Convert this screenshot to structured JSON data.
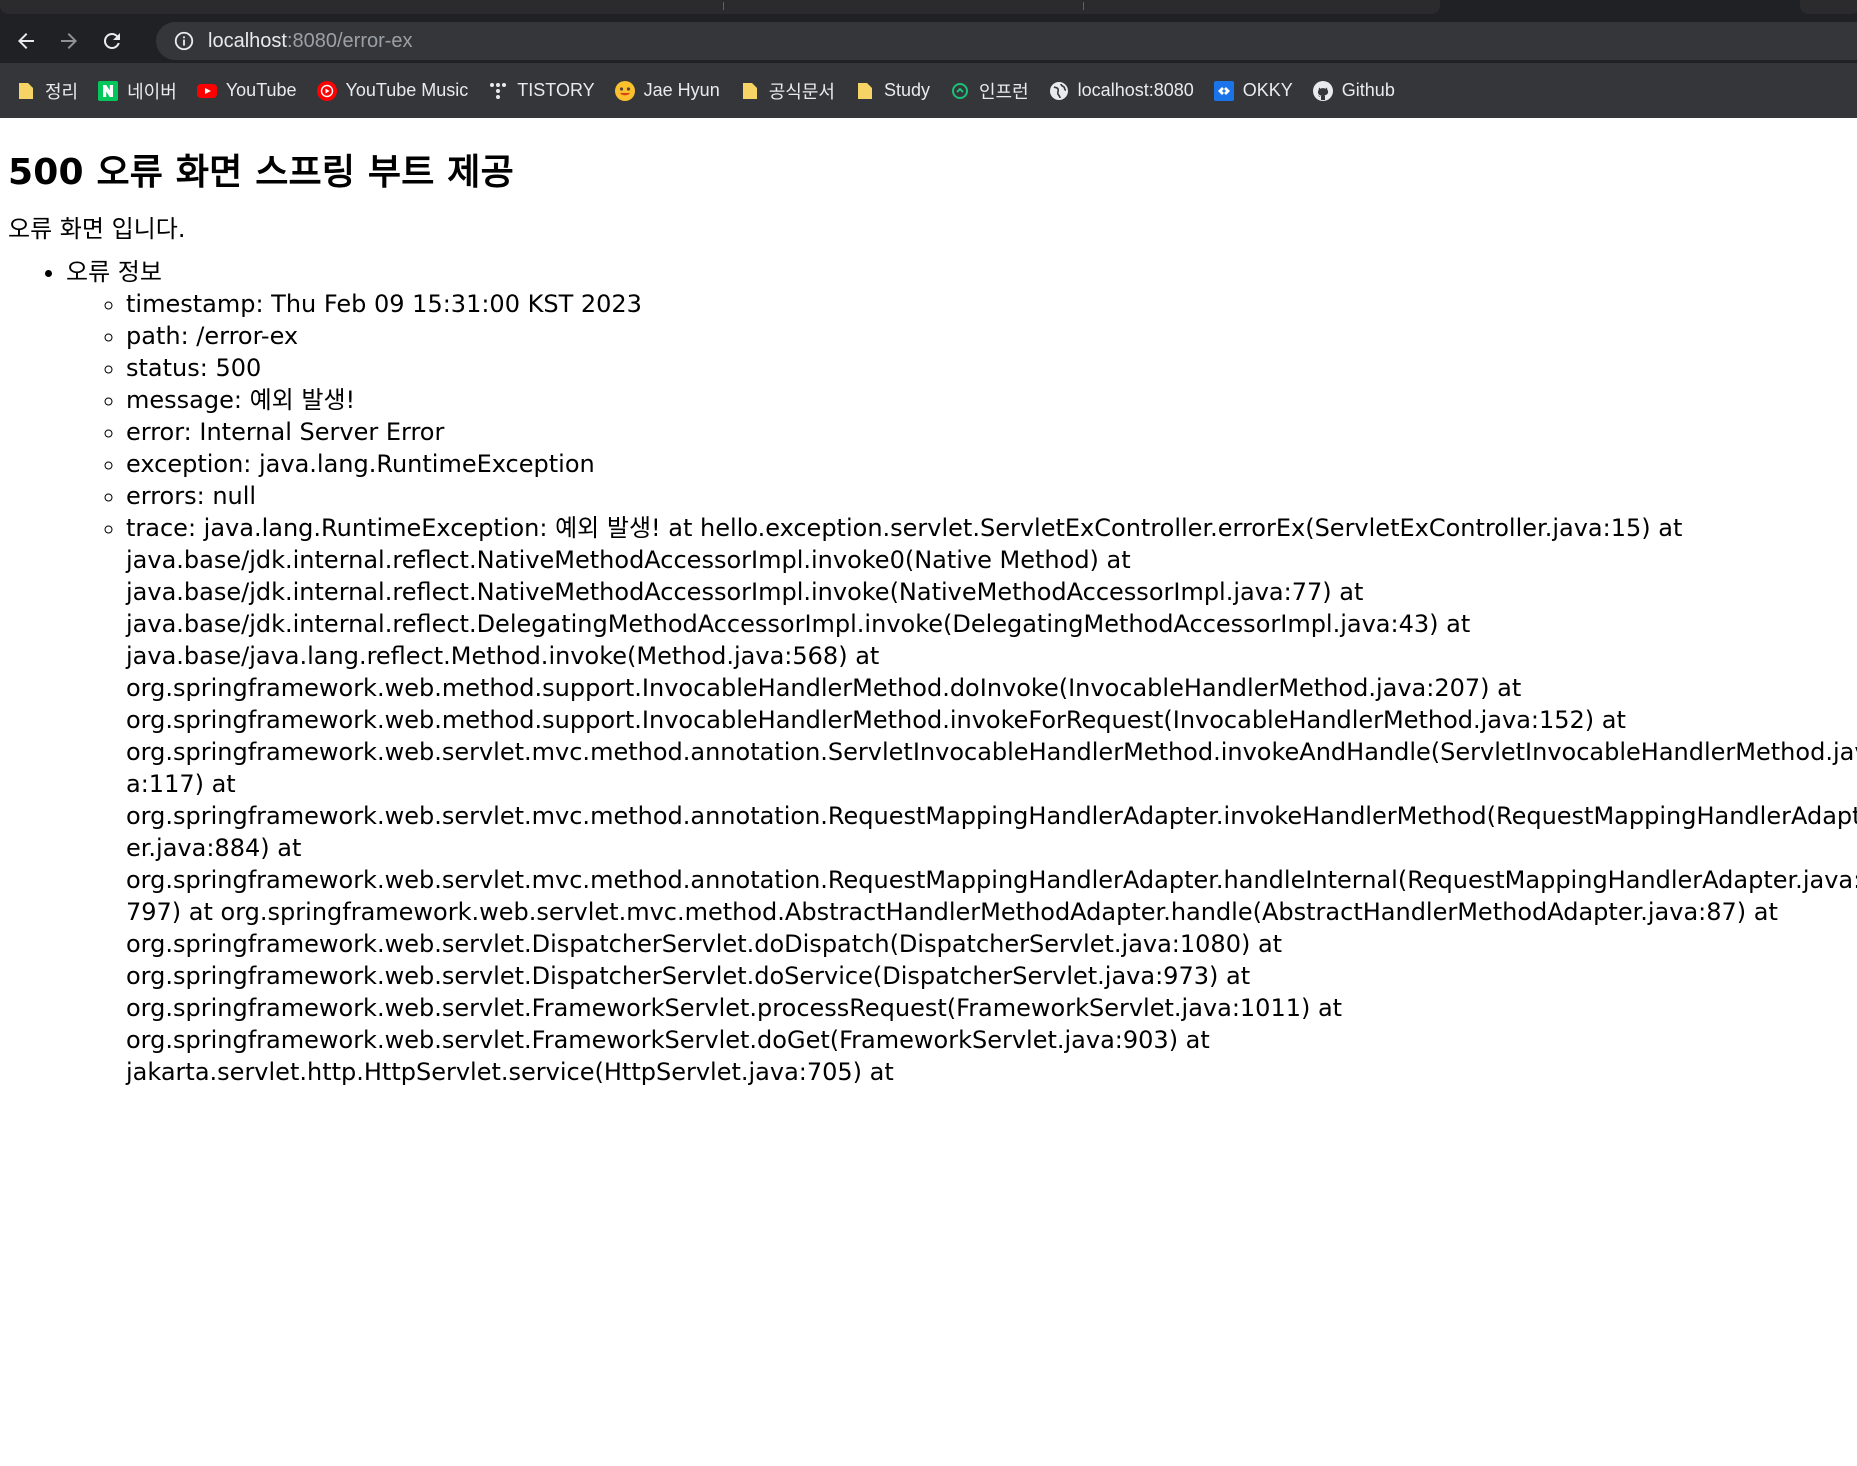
{
  "browser": {
    "url_host": "localhost",
    "url_path": ":8080/error-ex",
    "bookmarks": [
      {
        "label": "정리",
        "icon": "folder-icon"
      },
      {
        "label": "네이버",
        "icon": "naver-icon"
      },
      {
        "label": "YouTube",
        "icon": "youtube-icon"
      },
      {
        "label": "YouTube Music",
        "icon": "youtube-music-icon"
      },
      {
        "label": "TISTORY",
        "icon": "tistory-icon"
      },
      {
        "label": "Jae Hyun",
        "icon": "emoji-icon"
      },
      {
        "label": "공식문서",
        "icon": "folder-icon"
      },
      {
        "label": "Study",
        "icon": "folder-icon"
      },
      {
        "label": "인프런",
        "icon": "inflearn-icon"
      },
      {
        "label": "localhost:8080",
        "icon": "globe-icon"
      },
      {
        "label": "OKKY",
        "icon": "okky-icon"
      },
      {
        "label": "Github",
        "icon": "github-icon"
      }
    ],
    "colors": {
      "chrome_dark": "#202124",
      "toolbar": "#35363a",
      "text_light": "#e8eaed"
    }
  },
  "page": {
    "title": "500 오류 화면 스프링 부트 제공",
    "lead": "오류 화면 입니다.",
    "section_label": "오류 정보",
    "timestamp": "timestamp: Thu Feb 09 15:31:00 KST 2023",
    "path": "path: /error-ex",
    "status": "status: 500",
    "message": "message: 예외 발생!",
    "error": "error: Internal Server Error",
    "exception": "exception: java.lang.RuntimeException",
    "errors": "errors: null",
    "trace": "trace: java.lang.RuntimeException: 예외 발생! at hello.exception.servlet.ServletExController.errorEx(ServletExController.java:15) at java.base/jdk.internal.reflect.NativeMethodAccessorImpl.invoke0(Native Method) at java.base/jdk.internal.reflect.NativeMethodAccessorImpl.invoke(NativeMethodAccessorImpl.java:77) at java.base/jdk.internal.reflect.DelegatingMethodAccessorImpl.invoke(DelegatingMethodAccessorImpl.java:43) at java.base/java.lang.reflect.Method.invoke(Method.java:568) at org.springframework.web.method.support.InvocableHandlerMethod.doInvoke(InvocableHandlerMethod.java:207) at org.springframework.web.method.support.InvocableHandlerMethod.invokeForRequest(InvocableHandlerMethod.java:152) at org.springframework.web.servlet.mvc.method.annotation.ServletInvocableHandlerMethod.invokeAndHandle(ServletInvocableHandlerMethod.java:117) at org.springframework.web.servlet.mvc.method.annotation.RequestMappingHandlerAdapter.invokeHandlerMethod(RequestMappingHandlerAdapter.java:884) at org.springframework.web.servlet.mvc.method.annotation.RequestMappingHandlerAdapter.handleInternal(RequestMappingHandlerAdapter.java:797) at org.springframework.web.servlet.mvc.method.AbstractHandlerMethodAdapter.handle(AbstractHandlerMethodAdapter.java:87) at org.springframework.web.servlet.DispatcherServlet.doDispatch(DispatcherServlet.java:1080) at org.springframework.web.servlet.DispatcherServlet.doService(DispatcherServlet.java:973) at org.springframework.web.servlet.FrameworkServlet.processRequest(FrameworkServlet.java:1011) at org.springframework.web.servlet.FrameworkServlet.doGet(FrameworkServlet.java:903) at jakarta.servlet.http.HttpServlet.service(HttpServlet.java:705) at"
  }
}
